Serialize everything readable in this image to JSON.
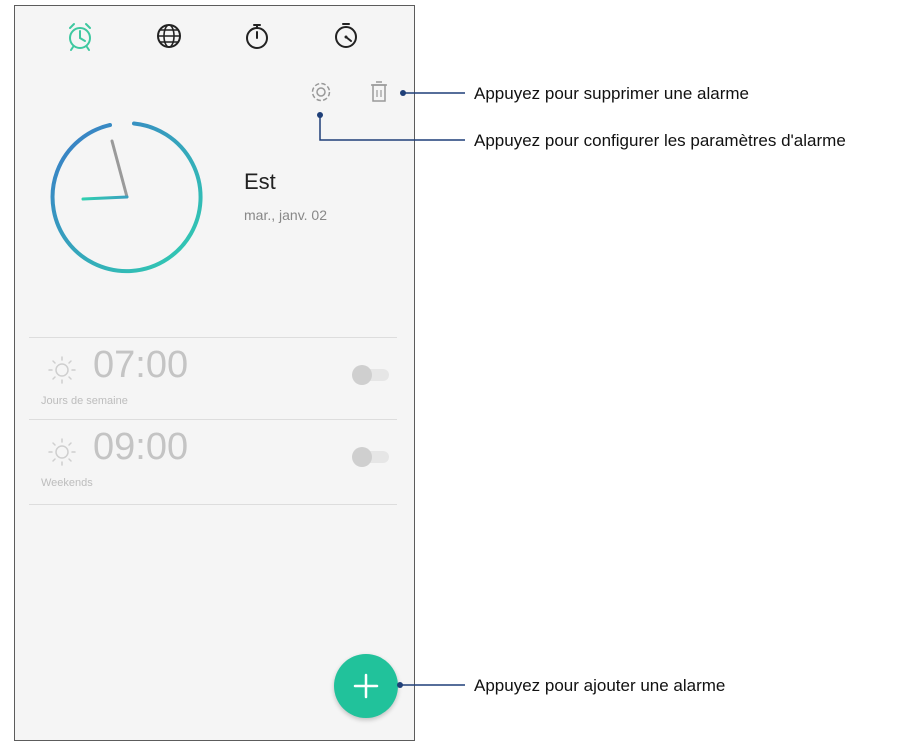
{
  "tabs": [
    {
      "icon": "alarm-clock-icon",
      "active": true
    },
    {
      "icon": "world-clock-icon",
      "active": false
    },
    {
      "icon": "stopwatch-icon",
      "active": false
    },
    {
      "icon": "timer-icon",
      "active": false
    }
  ],
  "toolbar": {
    "settings_icon": "gear-icon",
    "delete_icon": "trash-icon"
  },
  "clock": {
    "city": "Est",
    "date": "mar., janv. 02"
  },
  "alarms": [
    {
      "time": "07:00",
      "label": "Jours de semaine",
      "enabled": false
    },
    {
      "time": "09:00",
      "label": "Weekends",
      "enabled": false
    }
  ],
  "fab": {
    "icon": "plus-icon"
  },
  "callouts": {
    "delete": "Appuyez pour supprimer une alarme",
    "settings": "Appuyez pour configurer les paramètres d'alarme",
    "add": "Appuyez pour ajouter une alarme"
  },
  "colors": {
    "accent": "#21c29b",
    "active_tab": "#3ec8a0",
    "clock_gradient_start": "#3a79c8",
    "clock_gradient_end": "#30d0b0",
    "callout_line": "#1f3f78"
  }
}
